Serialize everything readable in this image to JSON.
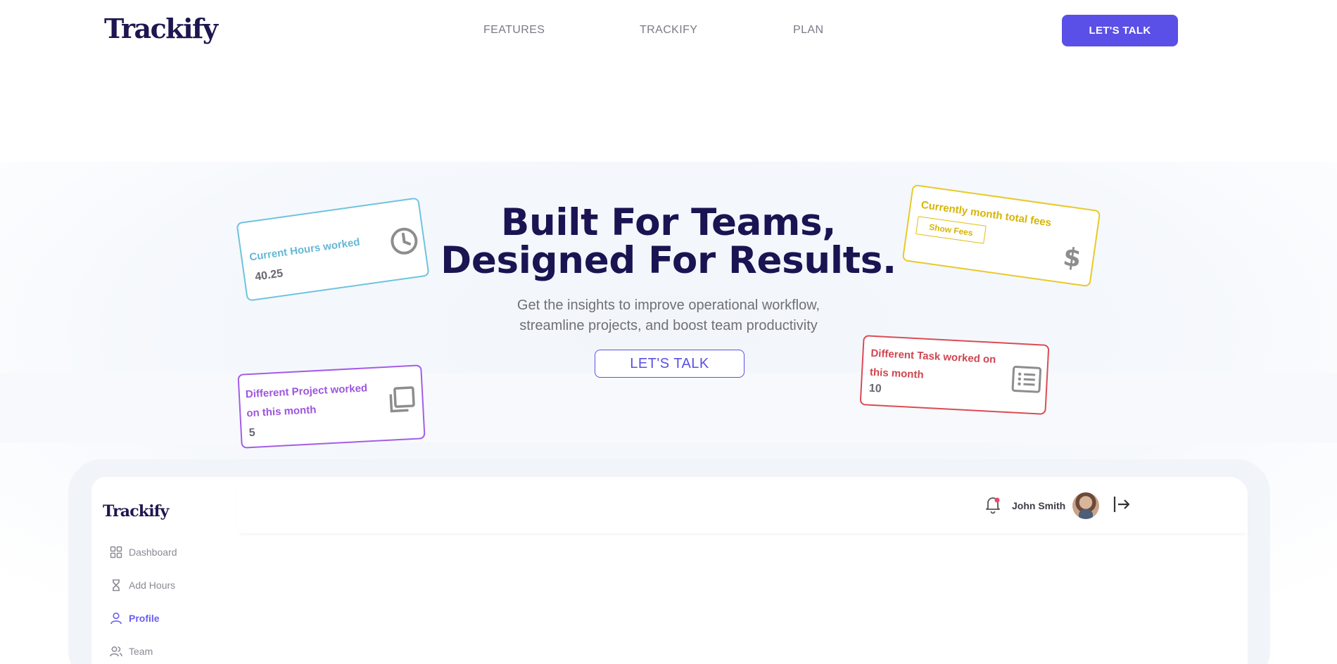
{
  "nav": {
    "logo": "Trackify",
    "links": [
      "FEATURES",
      "TRACKIFY",
      "PLAN"
    ],
    "cta": "LET'S TALK"
  },
  "hero": {
    "title_line1": "Built For Teams,",
    "title_line2": "Designed For Results.",
    "subtitle_line1": "Get the insights to improve operational workflow,",
    "subtitle_line2": "streamline projects, and boost team productivity",
    "cta": "LET'S TALK"
  },
  "cards": {
    "hours": {
      "title": "Current Hours worked",
      "value": "40.25",
      "icon": "clock-icon",
      "color": "#6ec3df"
    },
    "fees": {
      "title": "Currently month total fees",
      "button": "Show Fees",
      "icon": "dollar-icon",
      "color": "#e8c92a"
    },
    "project": {
      "title": "Different Project worked on this month",
      "value": "5",
      "icon": "copy-icon",
      "color": "#a35de6"
    },
    "task": {
      "title": "Different Task worked on this month",
      "value": "10",
      "icon": "list-icon",
      "color": "#dc4b55"
    }
  },
  "dashboard": {
    "logo": "Trackify",
    "sidebar": [
      {
        "label": "Dashboard",
        "icon": "grid-icon",
        "active": false
      },
      {
        "label": "Add Hours",
        "icon": "hourglass-icon",
        "active": false
      },
      {
        "label": "Profile",
        "icon": "user-icon",
        "active": true
      },
      {
        "label": "Team",
        "icon": "users-icon",
        "active": false
      }
    ],
    "user": {
      "name": "John Smith"
    }
  },
  "colors": {
    "accent": "#5a4fe6",
    "heading": "#1a1452"
  }
}
